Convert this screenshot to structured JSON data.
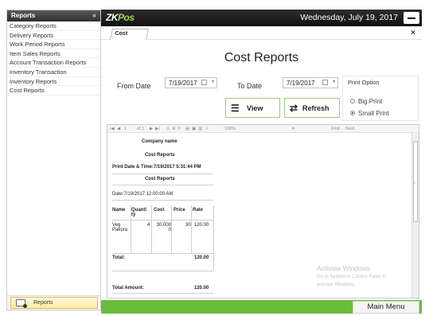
{
  "sidebar": {
    "header": "Reports",
    "collapse_icon": "«",
    "items": [
      {
        "label": "Category Reports"
      },
      {
        "label": "Delivery Reports"
      },
      {
        "label": "Work Period Reports"
      },
      {
        "label": "Item Sales Reports"
      },
      {
        "label": "Account Transaction Reports"
      },
      {
        "label": "Inventory Transaction"
      },
      {
        "label": "Inventory Reports"
      },
      {
        "label": "Cost Reports"
      }
    ],
    "footer_button": "Reports"
  },
  "topbar": {
    "logo_zk": "ZK",
    "logo_pos": "Pos",
    "date": "Wednesday, July 19, 2017",
    "minimize_icon": "minimize-icon"
  },
  "tab": {
    "label": "Cost",
    "close": "×"
  },
  "main": {
    "title": "Cost Reports",
    "from_label": "From Date",
    "from_value": "7/19/2017",
    "to_label": "To Date",
    "to_value": "7/19/2017",
    "view_label": "View",
    "refresh_label": "Refresh",
    "print_option_title": "Print Option",
    "big_print": "Big Print",
    "small_print": "Small Print",
    "selected_print": "Small Print"
  },
  "viewer_toolbar": {
    "nav_first": "|◀",
    "nav_prev": "◀",
    "page": "1",
    "of": "of 1",
    "nav_next": "▶",
    "nav_last": "▶|",
    "zoom": "100%",
    "find": "Find",
    "next": "Next"
  },
  "report": {
    "company": "Company name",
    "report_name": "Cost Reports",
    "print_date": "Print Date & Time:7/19/2017 5:31:44 PM",
    "section_title": "Cost Reports",
    "date_line": "Date:7/19/2017 12:00:00 AM",
    "columns": [
      "Name",
      "Quanti ty",
      "Cost",
      "Price",
      "Rate"
    ],
    "rows": [
      {
        "name": "Veg Pakora",
        "qty": "4",
        "cost": "30.000 0",
        "price": "30",
        "rate": "120.00"
      }
    ],
    "total_label": "Total:",
    "total_value": "120.00",
    "total_amount_label": "Total Amount:",
    "total_amount_value": "120.00"
  },
  "watermark": {
    "line1": "Activate Windows",
    "line2": "Go to System in Control Panel to",
    "line3": "activate Windows."
  },
  "bottombar": {
    "main_menu": "Main Menu"
  },
  "colors": {
    "accent_green": "#68be3a",
    "topbar": "#1a1a1a"
  }
}
